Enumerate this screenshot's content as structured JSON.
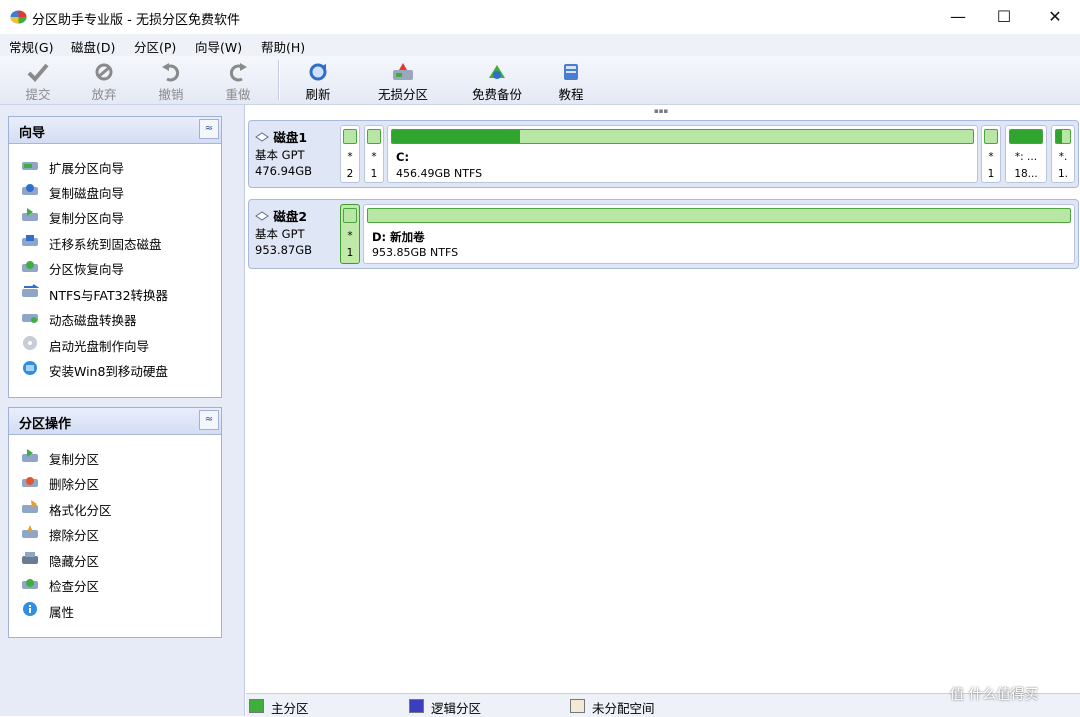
{
  "window": {
    "title": "分区助手专业版 - 无损分区免费软件",
    "minimize": "—",
    "maximize": "☐",
    "close": "✕"
  },
  "menu": [
    "常规(G)",
    "磁盘(D)",
    "分区(P)",
    "向导(W)",
    "帮助(H)"
  ],
  "toolbar": {
    "submit": "提交",
    "discard": "放弃",
    "undo": "撤销",
    "redo": "重做",
    "refresh": "刷新",
    "lossless": "无损分区",
    "backup": "免费备份",
    "tutorial": "教程"
  },
  "wizard_panel": {
    "title": "向导",
    "collapse": "≈",
    "items": [
      {
        "label": "扩展分区向导",
        "icon": "extend-partition-icon"
      },
      {
        "label": "复制磁盘向导",
        "icon": "copy-disk-icon"
      },
      {
        "label": "复制分区向导",
        "icon": "copy-partition-icon"
      },
      {
        "label": "迁移系统到固态磁盘",
        "icon": "migrate-os-icon"
      },
      {
        "label": "分区恢复向导",
        "icon": "partition-recovery-icon"
      },
      {
        "label": "NTFS与FAT32转换器",
        "icon": "ntfs-fat32-converter-icon"
      },
      {
        "label": "动态磁盘转换器",
        "icon": "dynamic-disk-converter-icon"
      },
      {
        "label": "启动光盘制作向导",
        "icon": "bootable-media-icon"
      },
      {
        "label": "安装Win8到移动硬盘",
        "icon": "windows-to-go-icon"
      }
    ]
  },
  "partition_panel": {
    "title": "分区操作",
    "collapse": "≈",
    "items": [
      {
        "label": "复制分区",
        "icon": "copy-partition-icon"
      },
      {
        "label": "删除分区",
        "icon": "delete-partition-icon"
      },
      {
        "label": "格式化分区",
        "icon": "format-partition-icon"
      },
      {
        "label": "擦除分区",
        "icon": "wipe-partition-icon"
      },
      {
        "label": "隐藏分区",
        "icon": "hide-partition-icon"
      },
      {
        "label": "检查分区",
        "icon": "check-partition-icon"
      },
      {
        "label": "属性",
        "icon": "properties-icon"
      }
    ]
  },
  "disks": [
    {
      "name": "磁盘1",
      "type": "基本 GPT",
      "size": "476.94GB",
      "partitions": [
        {
          "star": "*",
          "label": "2"
        },
        {
          "star": "*",
          "label": "1"
        },
        {
          "name": "C:",
          "desc": "456.49GB NTFS",
          "used_fraction": 0.22
        },
        {
          "star": "*",
          "label": "1"
        },
        {
          "star": "*: ...",
          "label": "18..."
        },
        {
          "star": "*.",
          "label": "1."
        }
      ]
    },
    {
      "name": "磁盘2",
      "type": "基本 GPT",
      "size": "953.87GB",
      "partitions": [
        {
          "star": "*",
          "label": "1"
        },
        {
          "name": "D: 新加卷",
          "desc": "953.85GB NTFS",
          "used_fraction": 0.0
        }
      ]
    }
  ],
  "legend": {
    "primary": "主分区",
    "logical": "逻辑分区",
    "unallocated": "未分配空间",
    "colors": {
      "primary": "#3fae3f",
      "logical": "#3b3fbf",
      "unallocated": "#f3e9d7"
    }
  },
  "watermark": "值 什么值得买"
}
